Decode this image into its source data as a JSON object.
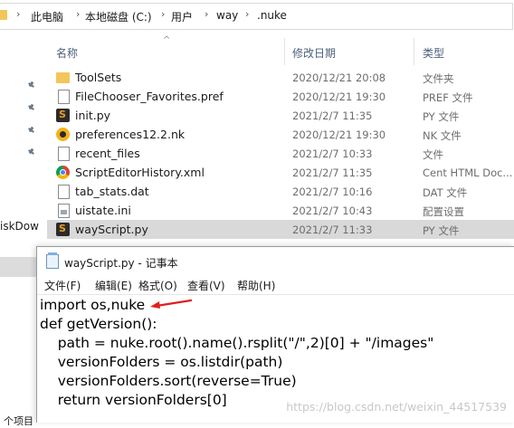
{
  "breadcrumb": {
    "segments": [
      "此电脑",
      "本地磁盘 (C:)",
      "用户",
      "way",
      ".nuke"
    ],
    "separator": "›"
  },
  "nav": {
    "partial_label": "iskDow",
    "partial_label_bottom": "个项目"
  },
  "columns": {
    "name": "名称",
    "date": "修改日期",
    "type": "类型"
  },
  "files": [
    {
      "name": "ToolSets",
      "date": "2020/12/21 20:08",
      "type": "文件夹",
      "icon": "folder-icon",
      "selected": false
    },
    {
      "name": "FileChooser_Favorites.pref",
      "date": "2020/12/21 19:30",
      "type": "PREF 文件",
      "icon": "document-icon",
      "selected": false
    },
    {
      "name": "init.py",
      "date": "2021/2/7 11:35",
      "type": "PY 文件",
      "icon": "python-file-icon",
      "selected": false
    },
    {
      "name": "preferences12.2.nk",
      "date": "2020/12/21 19:30",
      "type": "NK 文件",
      "icon": "nuke-file-icon",
      "selected": false
    },
    {
      "name": "recent_files",
      "date": "2021/2/7 10:33",
      "type": "文件",
      "icon": "document-icon",
      "selected": false
    },
    {
      "name": "ScriptEditorHistory.xml",
      "date": "2021/2/7 11:35",
      "type": "Cent HTML Doc...",
      "icon": "chrome-file-icon",
      "selected": false
    },
    {
      "name": "tab_stats.dat",
      "date": "2021/2/7 10:16",
      "type": "DAT 文件",
      "icon": "document-icon",
      "selected": false
    },
    {
      "name": "uistate.ini",
      "date": "2021/2/7 10:43",
      "type": "配置设置",
      "icon": "ini-file-icon",
      "selected": false
    },
    {
      "name": "wayScript.py",
      "date": "2021/2/7 11:33",
      "type": "PY 文件",
      "icon": "python-file-icon",
      "selected": true
    }
  ],
  "notepad": {
    "title": "wayScript.py - 记事本",
    "menu": [
      "文件(F)",
      "编辑(E)",
      "格式(O)",
      "查看(V)",
      "帮助(H)"
    ],
    "lines": [
      "import os,nuke",
      "def getVersion():",
      "    path = nuke.root().name().rsplit(\"/\",2)[0] + \"/images\"",
      "    versionFolders = os.listdir(path)",
      "    versionFolders.sort(reverse=True)",
      "    return versionFolders[0]"
    ],
    "watermark": "https://blog.csdn.net/weixin_44517539",
    "arrow_color": "#e02020"
  }
}
